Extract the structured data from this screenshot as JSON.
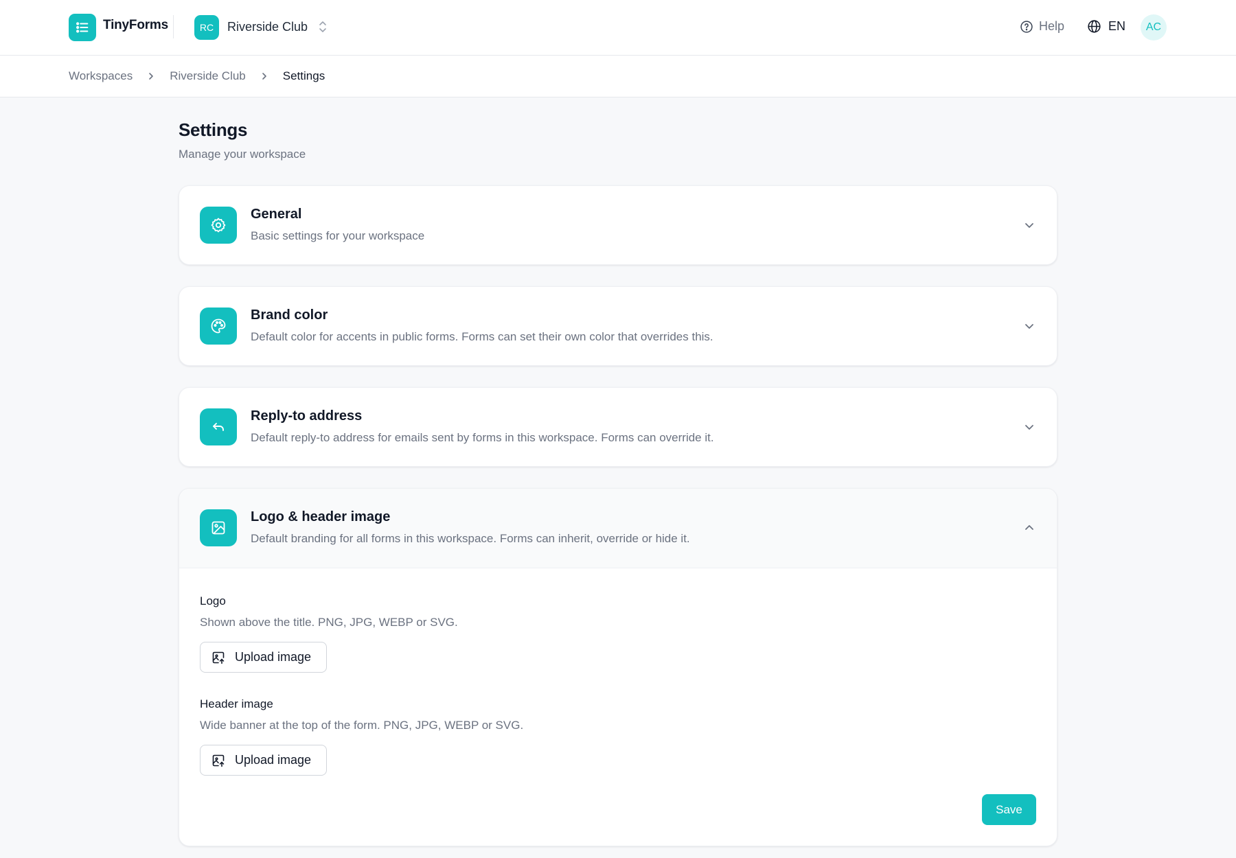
{
  "brand": {
    "app_name": "TinyForms",
    "accent": "#13bfbf",
    "logo_icon": "list-icon"
  },
  "workspace": {
    "initials": "RC",
    "name": "Riverside Club",
    "switch_icon": "chevron-up-down-icon"
  },
  "topbar": {
    "help_label": "Help",
    "help_icon": "question-circle-icon",
    "language": "EN",
    "language_icon": "globe-icon",
    "user_initials": "AC"
  },
  "breadcrumb": {
    "items": [
      "Workspaces",
      "Riverside Club",
      "Settings"
    ]
  },
  "page": {
    "title": "Settings",
    "subtitle": "Manage your workspace"
  },
  "sections": [
    {
      "title": "General",
      "description": "Basic settings for your workspace",
      "icon": "gear-icon",
      "expanded": false
    },
    {
      "title": "Brand color",
      "description": "Default color for accents in public forms. Forms can set their own color that overrides this.",
      "icon": "palette-icon",
      "expanded": false
    },
    {
      "title": "Reply-to address",
      "description": "Default reply-to address for emails sent by forms in this workspace. Forms can override it.",
      "icon": "reply-arrow-icon",
      "expanded": false
    },
    {
      "title": "Logo & header image",
      "description": "Default branding for all forms in this workspace. Forms can inherit, override or hide it.",
      "icon": "image-icon",
      "expanded": true,
      "fields": [
        {
          "label": "Logo",
          "hint": "Shown above the title. PNG, JPG, WEBP or SVG.",
          "button_label": "Upload image",
          "button_icon": "image-upload-icon"
        },
        {
          "label": "Header image",
          "hint": "Wide banner at the top of the form. PNG, JPG, WEBP or SVG.",
          "button_label": "Upload image",
          "button_icon": "image-upload-icon"
        }
      ],
      "save_label": "Save"
    }
  ]
}
